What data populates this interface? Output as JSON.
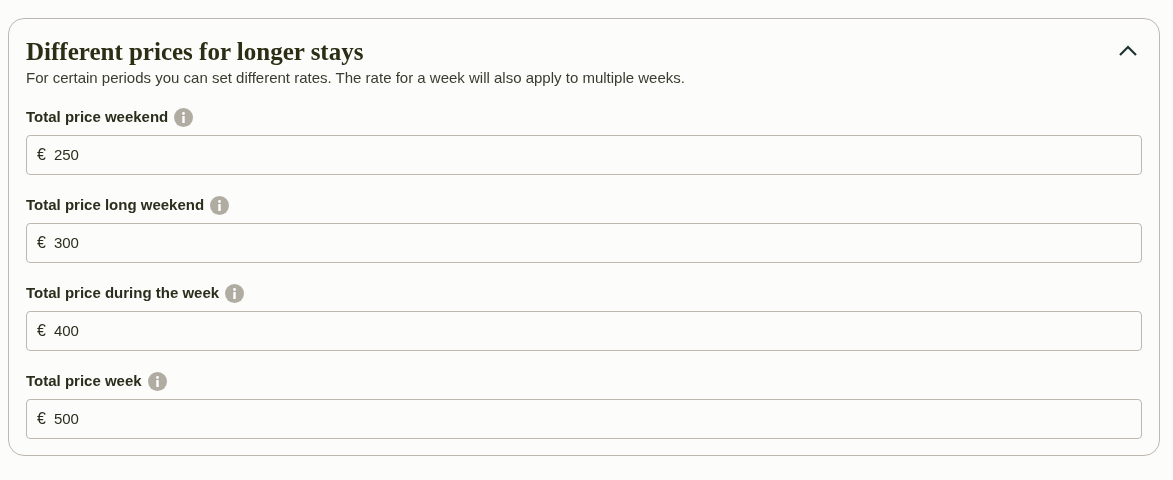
{
  "section": {
    "title": "Different prices for longer stays",
    "description": "For certain periods you can set different rates. The rate for a week will also apply to multiple weeks.",
    "expanded": true
  },
  "fields": [
    {
      "label": "Total price weekend",
      "currency": "€",
      "value": "250"
    },
    {
      "label": "Total price long weekend",
      "currency": "€",
      "value": "300"
    },
    {
      "label": "Total price during the week",
      "currency": "€",
      "value": "400"
    },
    {
      "label": "Total price week",
      "currency": "€",
      "value": "500"
    }
  ]
}
